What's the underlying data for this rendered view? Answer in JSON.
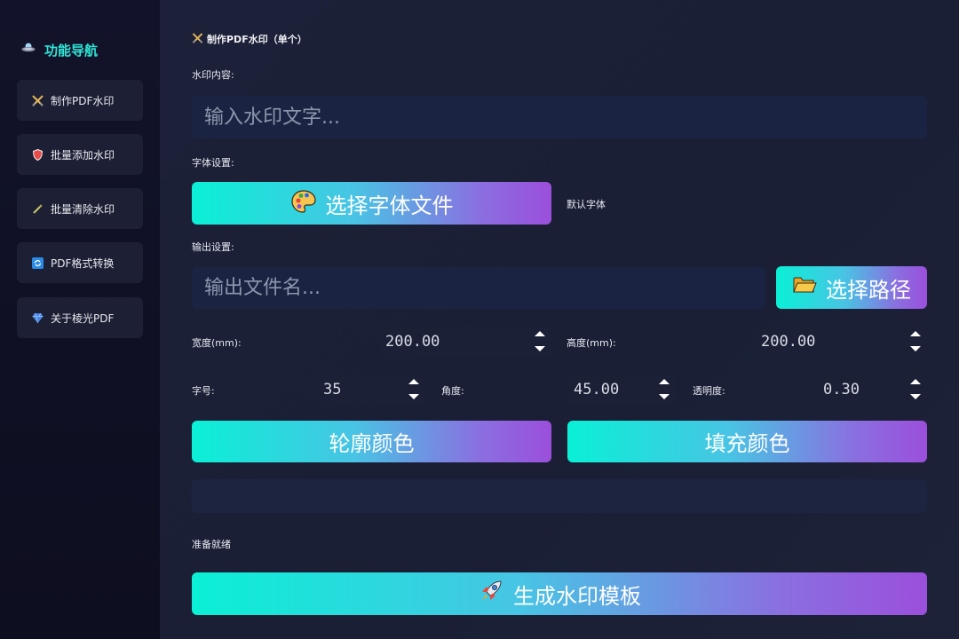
{
  "sidebar": {
    "title": "功能导航",
    "title_icon": "ufo-icon",
    "items": [
      {
        "label": "制作PDF水印",
        "icon": "crossed-swords-icon",
        "glyph": "⚔"
      },
      {
        "label": "批量添加水印",
        "icon": "shield-icon",
        "glyph": "🛡"
      },
      {
        "label": "批量清除水印",
        "icon": "magic-wand-icon",
        "glyph": "✨"
      },
      {
        "label": "PDF格式转换",
        "icon": "refresh-icon",
        "glyph": "🔄"
      },
      {
        "label": "关于棱光PDF",
        "icon": "gem-icon",
        "glyph": "💎"
      }
    ]
  },
  "main": {
    "section_title": "制作PDF水印（单个）",
    "watermark_label": "水印内容:",
    "watermark_placeholder": "输入水印文字...",
    "font_label": "字体设置:",
    "font_button": "选择字体文件",
    "font_current": "默认字体",
    "output_label": "输出设置:",
    "output_placeholder": "输出文件名...",
    "path_button": "选择路径",
    "width_label": "宽度(mm):",
    "width_value": "200.00",
    "height_label": "高度(mm):",
    "height_value": "200.00",
    "size_label": "字号:",
    "size_value": "35",
    "angle_label": "角度:",
    "angle_value": "45.00",
    "opacity_label": "透明度:",
    "opacity_value": "0.30",
    "outline_button": "轮廓颜色",
    "fill_button": "填充颜色",
    "status_text": "准备就绪",
    "generate_button": "生成水印模板"
  },
  "colors": {
    "accent": "#2ee6d6",
    "gradient_start": "#0af0d6",
    "gradient_end": "#9b4fdc",
    "background": "#1a1d31"
  }
}
